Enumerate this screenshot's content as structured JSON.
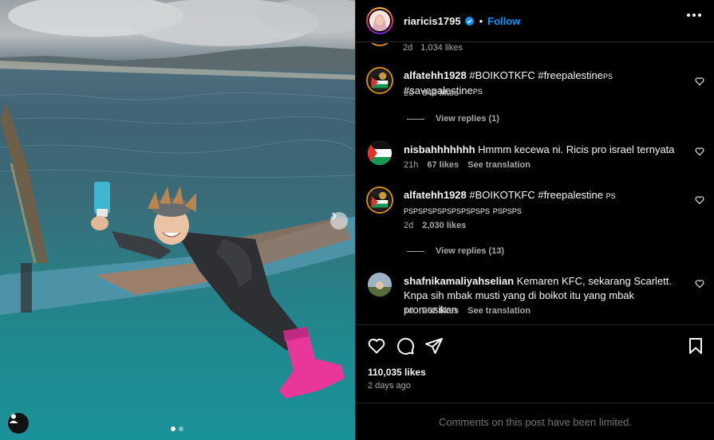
{
  "header": {
    "username": "riaricis1795",
    "separator": "•",
    "follow_label": "Follow"
  },
  "comments_top": {
    "time": "2d",
    "likes": "1,034 likes"
  },
  "comments": [
    {
      "username": "alfatehh1928",
      "text": "#BOIKOTKFC #freepalestine",
      "small1": "PS",
      "text2": " #savepalestine",
      "small2": "PS",
      "time": "2d",
      "likes": "843 likes",
      "view_replies": "View replies (1)"
    },
    {
      "username": "nisbahhhhhhh",
      "text": "Hmmm kecewa ni. Ricis pro israel ternyata",
      "time": "21h",
      "likes": "67 likes",
      "see_translation": "See translation"
    },
    {
      "username": "alfatehh1928",
      "text": "#BOIKOTKFC #freepalestine",
      "small1": "PS PSPSPSPSPSPSPSPSPS",
      "small2": "PSPSPS",
      "time": "2d",
      "likes": "2,030 likes",
      "view_replies": "View replies (13)"
    },
    {
      "username": "shafnikamaliyahselian",
      "text": "Kemaren KFC, sekarang Scarlett. Knpa sih mbak musti yang di boikot itu yang mbak promosikan",
      "time": "1d",
      "likes": "262 likes",
      "see_translation": "See translation"
    }
  ],
  "footer": {
    "likes": "110,035 likes",
    "posted": "2 days ago",
    "limited_notice": "Comments on this post have been limited."
  },
  "icons": {
    "like": "heart-icon",
    "comment": "comment-icon",
    "share": "share-icon",
    "save": "bookmark-icon",
    "more": "more-icon",
    "verified": "verified-badge-icon",
    "next": "chevron-right-icon",
    "user_tag": "user-tag-icon"
  },
  "carousel": {
    "total": 2,
    "current": 1
  },
  "colors": {
    "follow": "#0095f6",
    "verified": "#0095f6",
    "background": "#000000",
    "secondary_text": "#a8a8a8"
  }
}
